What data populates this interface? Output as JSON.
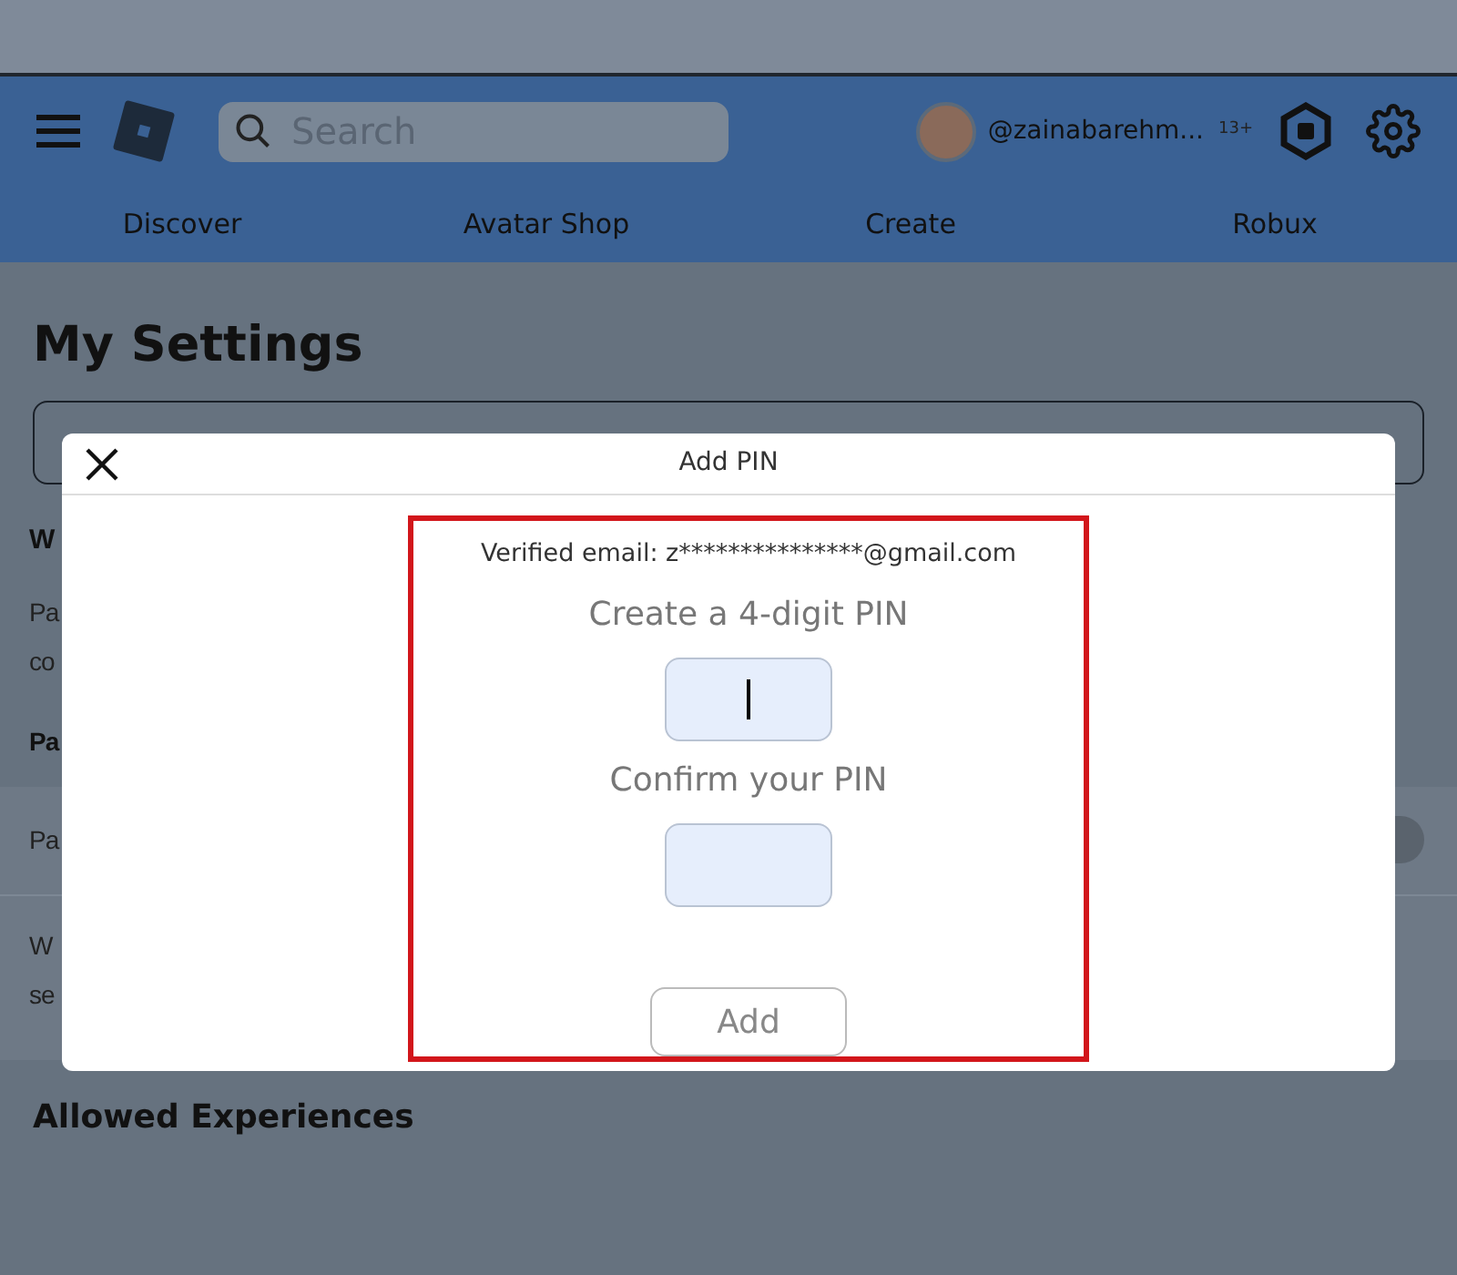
{
  "header": {
    "search": {
      "placeholder": "Search"
    },
    "username": "@zainabarehm...",
    "age_badge": "13+"
  },
  "nav": [
    {
      "label": "Discover"
    },
    {
      "label": "Avatar Shop"
    },
    {
      "label": "Create"
    },
    {
      "label": "Robux"
    }
  ],
  "page_title": "My Settings",
  "background_fragments": {
    "section_heading": "W",
    "paragraph_lines": [
      "Pa",
      "co"
    ],
    "subheading": "Pa",
    "toggle_row": {
      "label": "Pa",
      "on": false
    },
    "note_lines": [
      "W",
      "se"
    ]
  },
  "allowed_heading": "Allowed Experiences",
  "dialog": {
    "title": "Add PIN",
    "email_line": "Verified email: z***************@gmail.com",
    "create_label": "Create a 4-digit PIN",
    "create_focused": true,
    "confirm_label": "Confirm your PIN",
    "confirm_focused": false,
    "button": "Add"
  }
}
